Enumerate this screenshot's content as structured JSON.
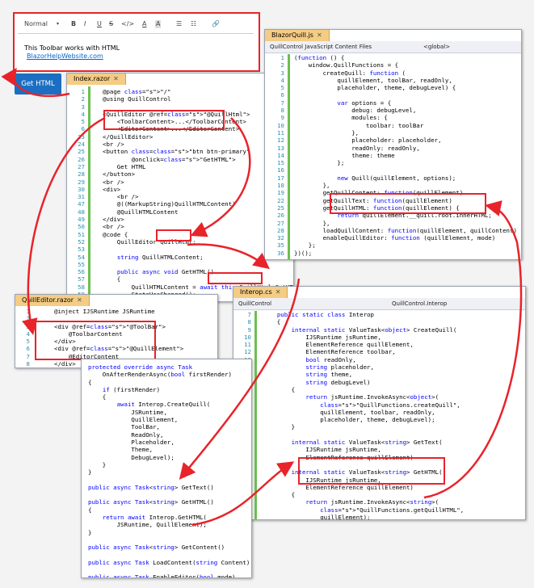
{
  "toolbar": {
    "style_select": "Normal",
    "tools": [
      "B",
      "I",
      "U",
      "S",
      "A",
      "A"
    ],
    "content": "This Toolbar works with HTML",
    "link": "BlazorHelpWebsite.com"
  },
  "get_html_button": "Get HTML",
  "index_razor": {
    "tab": "Index.razor",
    "lines": [
      {
        "n": "1",
        "t": "@page \"/\""
      },
      {
        "n": "2",
        "t": "@using QuillControl"
      },
      {
        "n": "3",
        "t": ""
      },
      {
        "n": "4",
        "t": "<QuillEditor @ref=\"@QuillHtml\">"
      },
      {
        "n": "5",
        "t": "    <ToolbarContent>...</ToolbarContent>"
      },
      {
        "n": "6",
        "t": "    <EditorContent>...</EditorContent>"
      },
      {
        "n": "23",
        "t": "</QuillEditor>"
      },
      {
        "n": "24",
        "t": "<br />"
      },
      {
        "n": "25",
        "t": "<button class=\"btn btn-primary\""
      },
      {
        "n": "26",
        "t": "        @onclick=\"GetHTML\">"
      },
      {
        "n": "27",
        "t": "    Get HTML"
      },
      {
        "n": "28",
        "t": "</button>"
      },
      {
        "n": "29",
        "t": "<br />"
      },
      {
        "n": "30",
        "t": "<div>"
      },
      {
        "n": "31",
        "t": "    <br />"
      },
      {
        "n": "47",
        "t": "    @((MarkupString)QuillHTMLContent)"
      },
      {
        "n": "48",
        "t": "    @QuillHTMLContent"
      },
      {
        "n": "49",
        "t": "</div>"
      },
      {
        "n": "50",
        "t": "<br />"
      },
      {
        "n": "51",
        "t": "@code {"
      },
      {
        "n": "52",
        "t": "    QuillEditor QuillHtml;"
      },
      {
        "n": "53",
        "t": ""
      },
      {
        "n": "54",
        "t": "    string QuillHTMLContent;"
      },
      {
        "n": "55",
        "t": ""
      },
      {
        "n": "56",
        "t": "    public async void GetHTML()"
      },
      {
        "n": "57",
        "t": "    {"
      },
      {
        "n": "58",
        "t": "        QuillHTMLContent = await this.QuillHtml.GetHTML();"
      },
      {
        "n": "59",
        "t": "        StateHasChanged();"
      }
    ]
  },
  "blazorquill_js": {
    "tab": "BlazorQuill.js",
    "project": "QuillControl JavaScript Content Files",
    "scope": "<global>",
    "lines": [
      {
        "n": "1",
        "t": "(function () {"
      },
      {
        "n": "2",
        "t": "    window.QuillFunctions = {"
      },
      {
        "n": "3",
        "t": "        createQuill: function ("
      },
      {
        "n": "4",
        "t": "            quillElement, toolBar, readOnly,"
      },
      {
        "n": "5",
        "t": "            placeholder, theme, debugLevel) {"
      },
      {
        "n": "6",
        "t": ""
      },
      {
        "n": "7",
        "t": "            var options = {"
      },
      {
        "n": "8",
        "t": "                debug: debugLevel,"
      },
      {
        "n": "9",
        "t": "                modules: {"
      },
      {
        "n": "10",
        "t": "                    toolbar: toolBar"
      },
      {
        "n": "11",
        "t": "                },"
      },
      {
        "n": "12",
        "t": "                placeholder: placeholder,"
      },
      {
        "n": "13",
        "t": "                readOnly: readOnly,"
      },
      {
        "n": "14",
        "t": "                theme: theme"
      },
      {
        "n": "15",
        "t": "            };"
      },
      {
        "n": "16",
        "t": ""
      },
      {
        "n": "17",
        "t": "            new Quill(quillElement, options);"
      },
      {
        "n": "18",
        "t": "        },"
      },
      {
        "n": "19",
        "t": "        getQuillContent: function(quillElement)"
      },
      {
        "n": "22",
        "t": "        getQuillText: function(quillElement)"
      },
      {
        "n": "25",
        "t": "        getQuillHTML: function(quillElement) {"
      },
      {
        "n": "26",
        "t": "            return quillElement.__quill.root.innerHTML;"
      },
      {
        "n": "27",
        "t": "        },"
      },
      {
        "n": "28",
        "t": "        loadQuillContent: function(quillElement, quillContent)"
      },
      {
        "n": "32",
        "t": "        enableQuillEditor: function (quillElement, mode)"
      },
      {
        "n": "35",
        "t": "    };"
      },
      {
        "n": "36",
        "t": "})();"
      }
    ]
  },
  "quilleditor_razor": {
    "tab": "QuillEditor.razor",
    "lines": [
      {
        "n": "1",
        "t": "@inject IJSRuntime JSRuntime"
      },
      {
        "n": "2",
        "t": ""
      },
      {
        "n": "3",
        "t": "<div @ref=\"@ToolBar\">"
      },
      {
        "n": "4",
        "t": "    @ToolbarContent"
      },
      {
        "n": "5",
        "t": "</div>"
      },
      {
        "n": "6",
        "t": "<div @ref=\"@QuillElement\">"
      },
      {
        "n": "7",
        "t": "    @EditorContent"
      },
      {
        "n": "8",
        "t": "</div>"
      }
    ],
    "code_lines": [
      "protected override async Task",
      "    OnAfterRenderAsync(bool firstRender)",
      "{",
      "    if (firstRender)",
      "    {",
      "        await Interop.CreateQuill(",
      "            JSRuntime,",
      "            QuillElement,",
      "            ToolBar,",
      "            ReadOnly,",
      "            Placeholder,",
      "            Theme,",
      "            DebugLevel);",
      "    }",
      "}",
      "",
      "public async Task<string> GetText()",
      "",
      "public async Task<string> GetHTML()",
      "{",
      "    return await Interop.GetHTML(",
      "        JSRuntime, QuillElement);",
      "}",
      "",
      "public async Task<string> GetContent()",
      "",
      "public async Task LoadContent(string Content)",
      "",
      "public async Task EnableEditor(bool mode)"
    ]
  },
  "interop_cs": {
    "tab": "Interop.cs",
    "project": "QuillControl",
    "scope": "QuillControl.Interop",
    "lines": [
      {
        "n": "7",
        "t": "    public static class Interop"
      },
      {
        "n": "8",
        "t": "    {"
      },
      {
        "n": "9",
        "t": "        internal static ValueTask<object> CreateQuill("
      },
      {
        "n": "10",
        "t": "            IJSRuntime jsRuntime,"
      },
      {
        "n": "11",
        "t": "            ElementReference quillElement,"
      },
      {
        "n": "12",
        "t": "            ElementReference toolbar,"
      },
      {
        "n": "13",
        "t": "            bool readOnly,"
      },
      {
        "n": "14",
        "t": "            string placeholder,"
      },
      {
        "n": "15",
        "t": "            string theme,"
      },
      {
        "n": "16",
        "t": "            string debugLevel)"
      },
      {
        "n": "17",
        "t": "        {"
      },
      {
        "n": "18",
        "t": "            return jsRuntime.InvokeAsync<object>("
      },
      {
        "n": "19",
        "t": "                \"QuillFunctions.createQuill\","
      },
      {
        "n": "20",
        "t": "                quillElement, toolbar, readOnly,"
      },
      {
        "n": "21",
        "t": "                placeholder, theme, debugLevel);"
      },
      {
        "n": "22",
        "t": "        }"
      },
      {
        "n": "23",
        "t": ""
      },
      {
        "n": "24",
        "t": "        internal static ValueTask<string> GetText("
      },
      {
        "n": "25",
        "t": "            IJSRuntime jsRuntime,"
      },
      {
        "n": "26",
        "t": "            ElementReference quillElement)"
      },
      {
        "n": "32",
        "t": ""
      },
      {
        "n": "33",
        "t": "        internal static ValueTask<string> GetHTML("
      },
      {
        "n": "34",
        "t": "            IJSRuntime jsRuntime,"
      },
      {
        "n": "35",
        "t": "            ElementReference quillElement)"
      },
      {
        "n": "36",
        "t": "        {"
      },
      {
        "n": "37",
        "t": "            return jsRuntime.InvokeAsync<string>("
      },
      {
        "n": "38",
        "t": "                \"QuillFunctions.getQuillHTML\","
      },
      {
        "n": "39",
        "t": "                quillElement);"
      },
      {
        "n": "40",
        "t": "        }"
      }
    ]
  },
  "colors": {
    "arrow": "#e8232a",
    "button": "#1b6ec2",
    "tab": "#f5cc84"
  }
}
